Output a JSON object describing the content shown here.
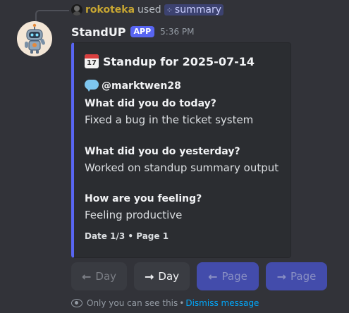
{
  "reply": {
    "username": "rokoteka",
    "used_text": "used",
    "command_icon": "slash-command-icon",
    "command": "summary"
  },
  "message": {
    "username": "StandUP",
    "badge": "APP",
    "timestamp": "5:36 PM",
    "avatar_icon": "robot-icon"
  },
  "embed": {
    "accent_color": "#5865f2",
    "title_icon": "calendar-icon",
    "calendar_month": "JUL",
    "calendar_day": "17",
    "title": "Standup for 2025-07-14",
    "author_icon": "speech-bubble-icon",
    "author": "@marktwen28",
    "fields": [
      {
        "name": "What did you do today?",
        "value": "Fixed a bug in the ticket system"
      },
      {
        "name": "What did you do yesterday?",
        "value": "Worked on standup summary output"
      },
      {
        "name": "How are you feeling?",
        "value": "Feeling productive"
      }
    ],
    "footer": "Date 1/3 • Page 1"
  },
  "buttons": [
    {
      "label": "Day",
      "arrow": "←",
      "enabled": false
    },
    {
      "label": "Day",
      "arrow": "→",
      "enabled": true
    },
    {
      "label": "Page",
      "arrow": "←",
      "enabled": false
    },
    {
      "label": "Page",
      "arrow": "→",
      "enabled": false
    }
  ],
  "ephemeral": {
    "icon": "eye-icon",
    "text": "Only you can see this",
    "separator": "•",
    "dismiss_label": "Dismiss message"
  },
  "colors": {
    "background": "#323339",
    "embed_background": "#2b2d31",
    "brand": "#5865f2",
    "link": "#00a8fc",
    "reply_username": "#c7a632"
  }
}
